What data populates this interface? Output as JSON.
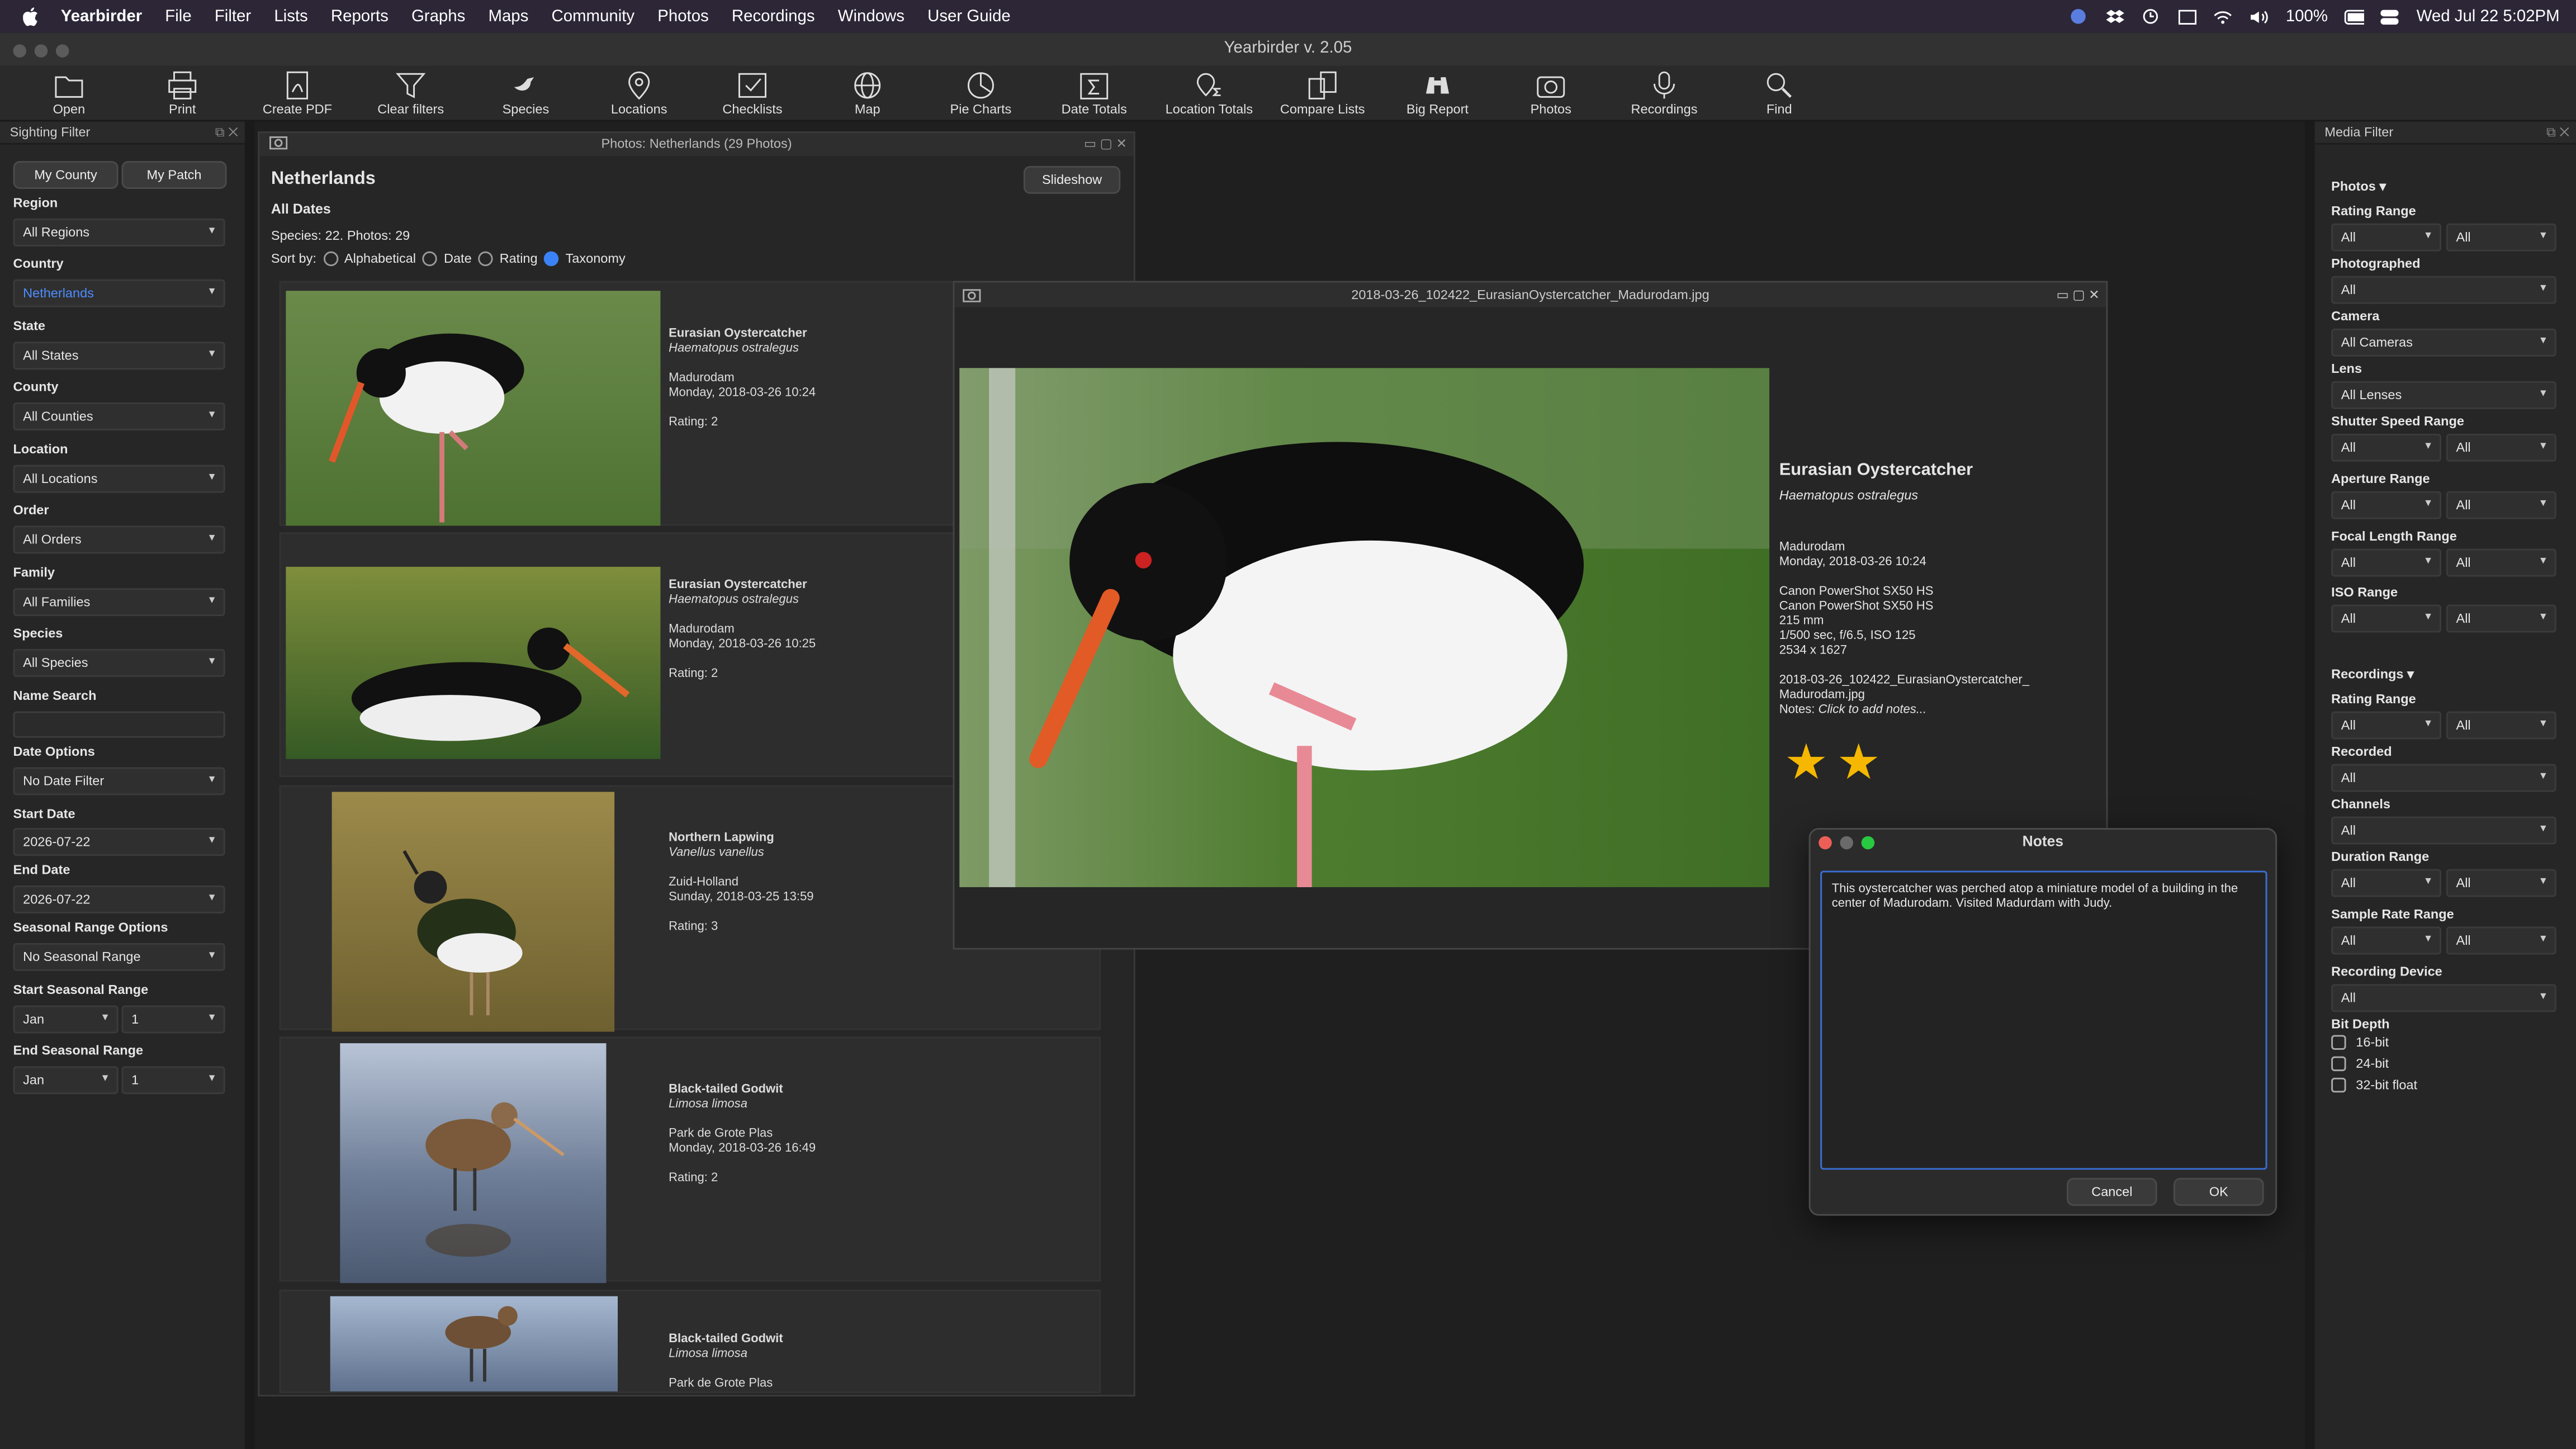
{
  "menubar": {
    "app": "Yearbirder",
    "items": [
      "File",
      "Filter",
      "Lists",
      "Reports",
      "Graphs",
      "Maps",
      "Community",
      "Photos",
      "Recordings",
      "Windows",
      "User Guide"
    ],
    "battery": "100%",
    "clock": "Wed Jul 22  5:02PM"
  },
  "window_title": "Yearbirder v. 2.05",
  "toolbar": [
    {
      "label": "Open",
      "icon": "folder-icon"
    },
    {
      "label": "Print",
      "icon": "printer-icon"
    },
    {
      "label": "Create PDF",
      "icon": "pdf-icon"
    },
    {
      "label": "Clear filters",
      "icon": "funnel-icon"
    },
    {
      "label": "Species",
      "icon": "bird-icon"
    },
    {
      "label": "Locations",
      "icon": "pin-icon"
    },
    {
      "label": "Checklists",
      "icon": "checklist-icon"
    },
    {
      "label": "Map",
      "icon": "globe-icon"
    },
    {
      "label": "Pie Charts",
      "icon": "pie-icon"
    },
    {
      "label": "Date Totals",
      "icon": "calendar-sum-icon"
    },
    {
      "label": "Location Totals",
      "icon": "pin-sum-icon"
    },
    {
      "label": "Compare Lists",
      "icon": "compare-icon"
    },
    {
      "label": "Big Report",
      "icon": "binoculars-icon"
    },
    {
      "label": "Photos",
      "icon": "camera-icon"
    },
    {
      "label": "Recordings",
      "icon": "microphone-icon"
    },
    {
      "label": "Find",
      "icon": "magnifier-icon"
    }
  ],
  "sighting_filter": {
    "title": "Sighting Filter",
    "my_county": "My County",
    "my_patch": "My Patch",
    "fields": [
      {
        "label": "Region",
        "value": "All Regions"
      },
      {
        "label": "Country",
        "value": "Netherlands"
      },
      {
        "label": "State",
        "value": "All States"
      },
      {
        "label": "County",
        "value": "All Counties"
      },
      {
        "label": "Location",
        "value": "All Locations"
      },
      {
        "label": "Order",
        "value": "All Orders"
      },
      {
        "label": "Family",
        "value": "All Families"
      },
      {
        "label": "Species",
        "value": "All Species"
      }
    ],
    "name_search_label": "Name Search",
    "date_options_label": "Date Options",
    "date_options_value": "No Date Filter",
    "start_date_label": "Start Date",
    "start_date": "2026-07-22",
    "end_date_label": "End Date",
    "end_date": "2026-07-22",
    "seasonal_label": "Seasonal Range Options",
    "seasonal_value": "No Seasonal Range",
    "start_seasonal_label": "Start Seasonal Range",
    "start_month": "Jan",
    "start_day": "1",
    "end_seasonal_label": "End Seasonal Range",
    "end_month": "Jan",
    "end_day": "1"
  },
  "photos_window": {
    "title": "Photos: Netherlands (29 Photos)",
    "heading": "Netherlands",
    "subheading": "All Dates",
    "slideshow": "Slideshow",
    "counts": "Species: 22. Photos: 29",
    "sort_label": "Sort by:",
    "sort_options": [
      "Alphabetical",
      "Date",
      "Rating",
      "Taxonomy"
    ],
    "sort_selected": "Taxonomy",
    "items": [
      {
        "common": "Eurasian Oystercatcher",
        "sci": "Haematopus ostralegus",
        "place": "Madurodam",
        "date": "Monday, 2018-03-26 10:24",
        "rating": "Rating: 2"
      },
      {
        "common": "Eurasian Oystercatcher",
        "sci": "Haematopus ostralegus",
        "place": "Madurodam",
        "date": "Monday, 2018-03-26 10:25",
        "rating": "Rating: 2"
      },
      {
        "common": "Northern Lapwing",
        "sci": "Vanellus vanellus",
        "place": "Zuid-Holland",
        "date": "Sunday, 2018-03-25 13:59",
        "rating": "Rating: 3"
      },
      {
        "common": "Black-tailed Godwit",
        "sci": "Limosa limosa",
        "place": "Park de Grote Plas",
        "date": "Monday, 2018-03-26 16:49",
        "rating": "Rating: 2"
      },
      {
        "common": "Black-tailed Godwit",
        "sci": "Limosa limosa",
        "place": "Park de Grote Plas",
        "date": "",
        "rating": ""
      }
    ]
  },
  "viewer": {
    "title": "2018-03-26_102422_EurasianOystercatcher_Madurodam.jpg",
    "common": "Eurasian Oystercatcher",
    "sci": "Haematopus ostralegus",
    "place": "Madurodam",
    "date": "Monday, 2018-03-26 10:24",
    "camera1": "Canon PowerShot SX50 HS",
    "camera2": "Canon PowerShot SX50 HS",
    "focal": "215 mm",
    "exposure": "1/500 sec, f/6.5, ISO 125",
    "dims": "2534 x 1627",
    "file1": "2018-03-26_102422_EurasianOystercatcher_",
    "file2": "Madurodam.jpg",
    "notes_label": "Notes:",
    "notes_hint": "Click to add notes...",
    "stars": 2
  },
  "notes_dialog": {
    "title": "Notes",
    "text": "This oystercatcher was perched atop a miniature model of a building in the center of Madurodam.  Visited Madurdam with Judy.",
    "cancel": "Cancel",
    "ok": "OK"
  },
  "media_filter": {
    "title": "Media Filter",
    "photos_header": "Photos",
    "photo_fields": [
      {
        "label": "Rating Range",
        "a": "All",
        "b": "All"
      },
      {
        "label": "Photographed",
        "a": "All"
      },
      {
        "label": "Camera",
        "a": "All Cameras"
      },
      {
        "label": "Lens",
        "a": "All Lenses"
      },
      {
        "label": "Shutter Speed Range",
        "a": "All",
        "b": "All"
      },
      {
        "label": "Aperture Range",
        "a": "All",
        "b": "All"
      },
      {
        "label": "Focal Length Range",
        "a": "All",
        "b": "All"
      },
      {
        "label": "ISO Range",
        "a": "All",
        "b": "All"
      }
    ],
    "recordings_header": "Recordings",
    "rec_fields": [
      {
        "label": "Rating Range",
        "a": "All",
        "b": "All"
      },
      {
        "label": "Recorded",
        "a": "All"
      },
      {
        "label": "Channels",
        "a": "All"
      },
      {
        "label": "Duration Range",
        "a": "All",
        "b": "All"
      },
      {
        "label": "Sample Rate Range",
        "a": "All",
        "b": "All"
      },
      {
        "label": "Recording Device",
        "a": "All"
      }
    ],
    "bit_depth_label": "Bit Depth",
    "bit_depths": [
      "16-bit",
      "24-bit",
      "32-bit float"
    ]
  },
  "colors": {
    "accent": "#3b82f6",
    "star": "#f5b700",
    "selected_text": "#4e8cff"
  }
}
